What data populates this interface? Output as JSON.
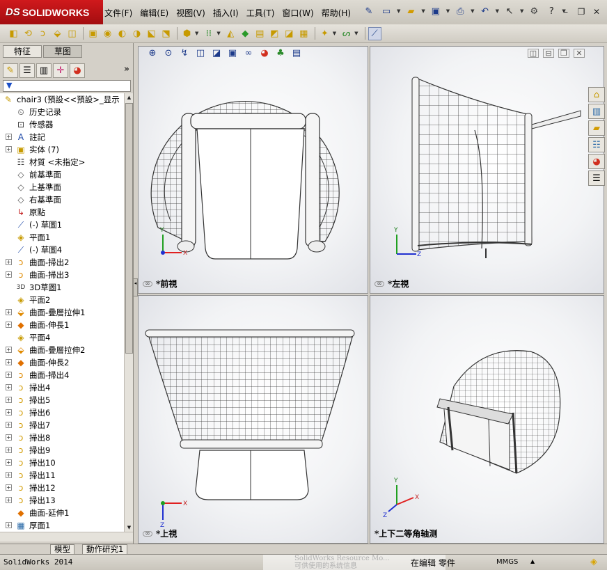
{
  "app": {
    "logo_text": "SOLIDWORKS",
    "logo_mark": "DS"
  },
  "menu": [
    "文件(F)",
    "编辑(E)",
    "视图(V)",
    "插入(I)",
    "工具(T)",
    "窗口(W)",
    "帮助(H)"
  ],
  "panel": {
    "tabs": [
      "特征",
      "草图"
    ],
    "selected_tab": "草图"
  },
  "tree": [
    {
      "label": "chair3  (預設<<預設>_显示",
      "icon": "part-icon",
      "root": true
    },
    {
      "label": "历史记录",
      "icon": "history-icon",
      "expand": false
    },
    {
      "label": "传感器",
      "icon": "sensor-icon",
      "expand": false
    },
    {
      "label": "註記",
      "icon": "annotation-icon",
      "expand": true
    },
    {
      "label": "实体 (7)",
      "icon": "solid-bodies-icon",
      "expand": true
    },
    {
      "label": "材質 <未指定>",
      "icon": "material-icon",
      "expand": false
    },
    {
      "label": "前基準面",
      "icon": "plane-icon",
      "expand": false
    },
    {
      "label": "上基準面",
      "icon": "plane-icon",
      "expand": false
    },
    {
      "label": "右基準面",
      "icon": "plane-icon",
      "expand": false
    },
    {
      "label": "原點",
      "icon": "origin-icon",
      "expand": false
    },
    {
      "label": "(-) 草圖1",
      "icon": "sketch-icon",
      "expand": false
    },
    {
      "label": "平面1",
      "icon": "ref-plane-icon",
      "expand": false
    },
    {
      "label": "(-) 草圖4",
      "icon": "sketch-icon",
      "expand": false
    },
    {
      "label": "曲面-掃出2",
      "icon": "surface-sweep-icon",
      "expand": true
    },
    {
      "label": "曲面-掃出3",
      "icon": "surface-sweep-icon",
      "expand": true
    },
    {
      "label": "3D草圖1",
      "icon": "3d-sketch-icon",
      "expand": false
    },
    {
      "label": "平面2",
      "icon": "ref-plane-icon",
      "expand": false
    },
    {
      "label": "曲面-疊層拉伸1",
      "icon": "surface-loft-icon",
      "expand": true
    },
    {
      "label": "曲面-伸長1",
      "icon": "surface-extend-icon",
      "expand": true
    },
    {
      "label": "平面4",
      "icon": "ref-plane-icon",
      "expand": false
    },
    {
      "label": "曲面-疊層拉伸2",
      "icon": "surface-loft-icon",
      "expand": true
    },
    {
      "label": "曲面-伸長2",
      "icon": "surface-extend-icon",
      "expand": true
    },
    {
      "label": "曲面-掃出4",
      "icon": "surface-sweep-icon",
      "expand": true
    },
    {
      "label": "掃出4",
      "icon": "sweep-icon",
      "expand": true
    },
    {
      "label": "掃出5",
      "icon": "sweep-icon",
      "expand": true
    },
    {
      "label": "掃出6",
      "icon": "sweep-icon",
      "expand": true
    },
    {
      "label": "掃出7",
      "icon": "sweep-icon",
      "expand": true
    },
    {
      "label": "掃出8",
      "icon": "sweep-icon",
      "expand": true
    },
    {
      "label": "掃出9",
      "icon": "sweep-icon",
      "expand": true
    },
    {
      "label": "掃出10",
      "icon": "sweep-icon",
      "expand": true
    },
    {
      "label": "掃出11",
      "icon": "sweep-icon",
      "expand": true
    },
    {
      "label": "掃出12",
      "icon": "sweep-icon",
      "expand": true
    },
    {
      "label": "掃出13",
      "icon": "sweep-icon",
      "expand": true
    },
    {
      "label": "曲面-延伸1",
      "icon": "surface-extend-icon",
      "expand": false
    },
    {
      "label": "厚面1",
      "icon": "thicken-icon",
      "expand": true
    }
  ],
  "viewports": {
    "front": "*前視",
    "left": "*左視",
    "top": "*上視",
    "iso": "*上下二等角轴测"
  },
  "axes": {
    "x": "X",
    "y": "Y",
    "z": "Z"
  },
  "bottom_tabs": [
    "模型",
    "動作研究1"
  ],
  "status": {
    "left": "SolidWorks 2014",
    "watermark": "SolidWorks Resource Mo...",
    "watermark_line2": "可供使用的系统信息",
    "editing": "在编辑 零件",
    "units": "MMGS"
  },
  "colors": {
    "brand_red": "#c0121a",
    "axis_x": "#e02020",
    "axis_y": "#20a020",
    "axis_z": "#2030d0"
  }
}
